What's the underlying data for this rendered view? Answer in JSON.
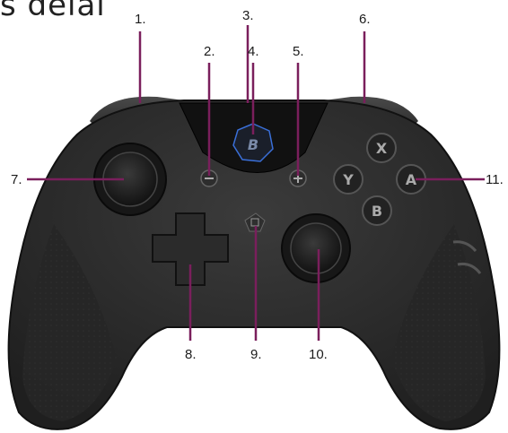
{
  "heading": "s delai",
  "callouts": [
    "1.",
    "2.",
    "3.",
    "4.",
    "5.",
    "6.",
    "7.",
    "8.",
    "9.",
    "10.",
    "11."
  ],
  "face_buttons": {
    "top": "X",
    "left": "Y",
    "right": "A",
    "bottom": "B"
  },
  "colors": {
    "leader": "#7a1f5c",
    "body": "#2a2a2a",
    "accent_blue": "#3a6fd8"
  }
}
